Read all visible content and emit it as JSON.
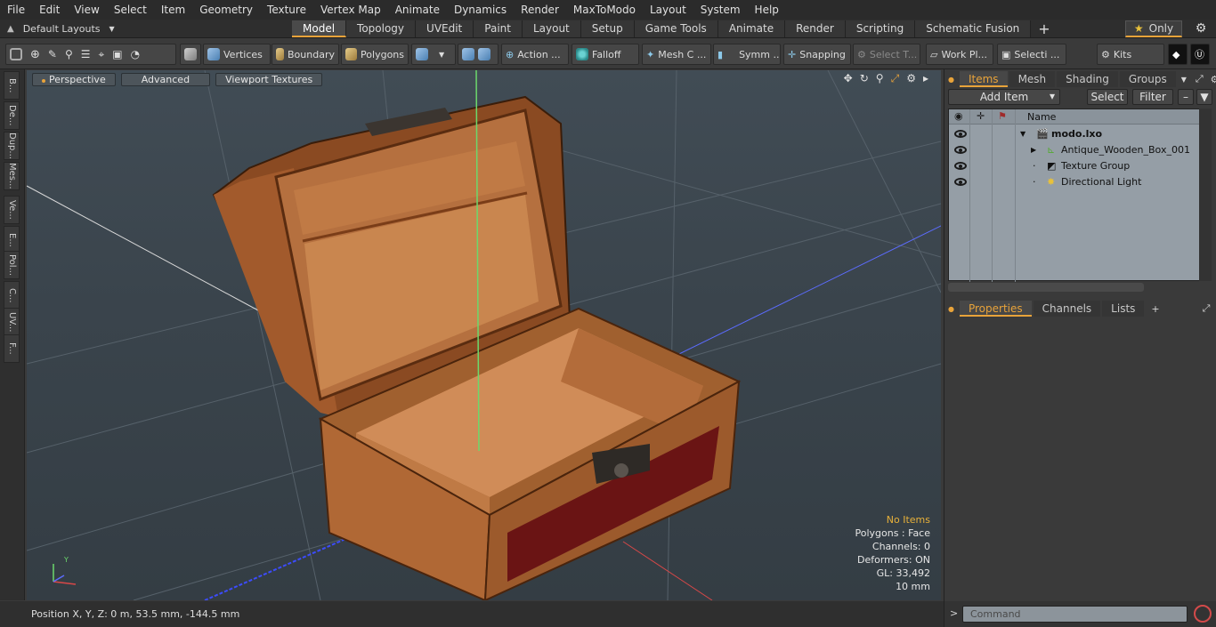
{
  "menu": [
    "File",
    "Edit",
    "View",
    "Select",
    "Item",
    "Geometry",
    "Texture",
    "Vertex Map",
    "Animate",
    "Dynamics",
    "Render",
    "MaxToModo",
    "Layout",
    "System",
    "Help"
  ],
  "layouts": {
    "label": "Default Layouts"
  },
  "tabs": [
    "Model",
    "Topology",
    "UVEdit",
    "Paint",
    "Layout",
    "Setup",
    "Game Tools",
    "Animate",
    "Render",
    "Scripting",
    "Schematic Fusion"
  ],
  "tabs_active": "Model",
  "only_label": "Only",
  "toolbar": {
    "vertices": "Vertices",
    "boundary": "Boundary",
    "polygons": "Polygons",
    "action": "Action ...",
    "falloff": "Falloff",
    "mesh": "Mesh C ...",
    "symm": "Symm ...",
    "snapping": "Snapping",
    "select_t": "Select T...",
    "work_pl": "Work Pl...",
    "selecti": "Selecti ...",
    "kits": "Kits"
  },
  "leftstrip": [
    "B...",
    "De...",
    "Dup...",
    "Mes...",
    "Ve...",
    "E...",
    "Pol...",
    "C...",
    "UV...",
    "F..."
  ],
  "viewport": {
    "perspective": "Perspective",
    "advanced": "Advanced",
    "textures": "Viewport Textures",
    "info": {
      "no_items": "No Items",
      "polygons": "Polygons : Face",
      "channels": "Channels: 0",
      "deformers": "Deformers: ON",
      "gl": "GL: 33,492",
      "scale": "10 mm"
    }
  },
  "status": {
    "position": "Position X, Y, Z:   0 m, 53.5 mm, -144.5 mm"
  },
  "items_panel": {
    "tabs": [
      "Items",
      "Mesh ...",
      "Shading",
      "Groups"
    ],
    "add_item": "Add Item",
    "select": "Select",
    "filter": "Filter",
    "col_name": "Name",
    "rows": [
      {
        "label": "modo.lxo",
        "bold": true
      },
      {
        "label": "Antique_Wooden_Box_001"
      },
      {
        "label": "Texture Group"
      },
      {
        "label": "Directional Light"
      }
    ]
  },
  "props_panel": {
    "tabs": [
      "Properties",
      "Channels",
      "Lists"
    ]
  },
  "command": {
    "placeholder": "Command"
  },
  "colors": {
    "accent": "#e8a33a",
    "viewport_bg": "#3a444c",
    "wood": "#b8703a",
    "velvet": "#6a1414"
  }
}
